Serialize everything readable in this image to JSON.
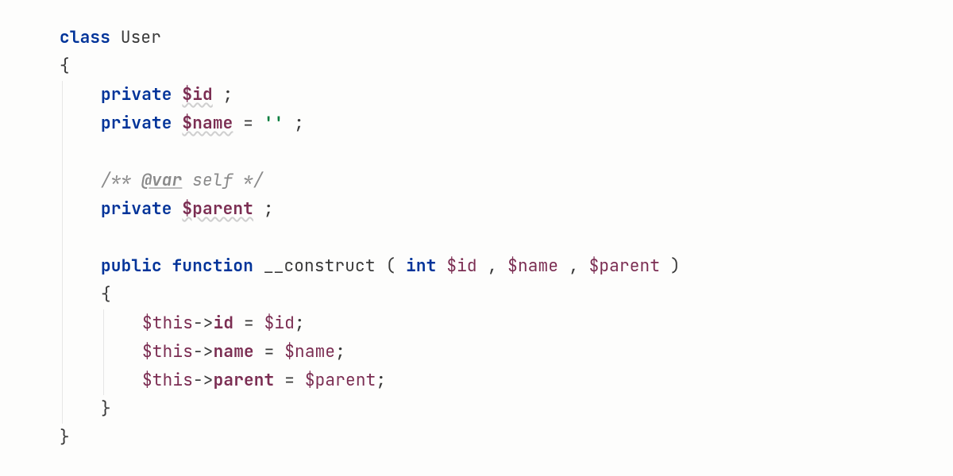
{
  "code": {
    "kw_class": "class",
    "classname": "User",
    "brace_open": "{",
    "brace_close": "}",
    "kw_private": "private",
    "kw_public": "public",
    "kw_function": "function",
    "var_id": "$id",
    "var_name": "$name",
    "var_parent": "$parent",
    "empty_string": "''",
    "doc_open": "/** ",
    "doc_tag": "@var",
    "doc_self": " self ",
    "doc_close": "*/",
    "func_name": "__construct",
    "kw_int": "int",
    "param_id": "$id",
    "param_name": "$name",
    "param_parent": "$parent",
    "this": "$this",
    "arrow": "->",
    "field_id": "id",
    "field_name": "name",
    "field_parent": "parent",
    "eq": " = ",
    "semi": ";",
    "comma": ", ",
    "lparen": "(",
    "rparen": ")"
  }
}
